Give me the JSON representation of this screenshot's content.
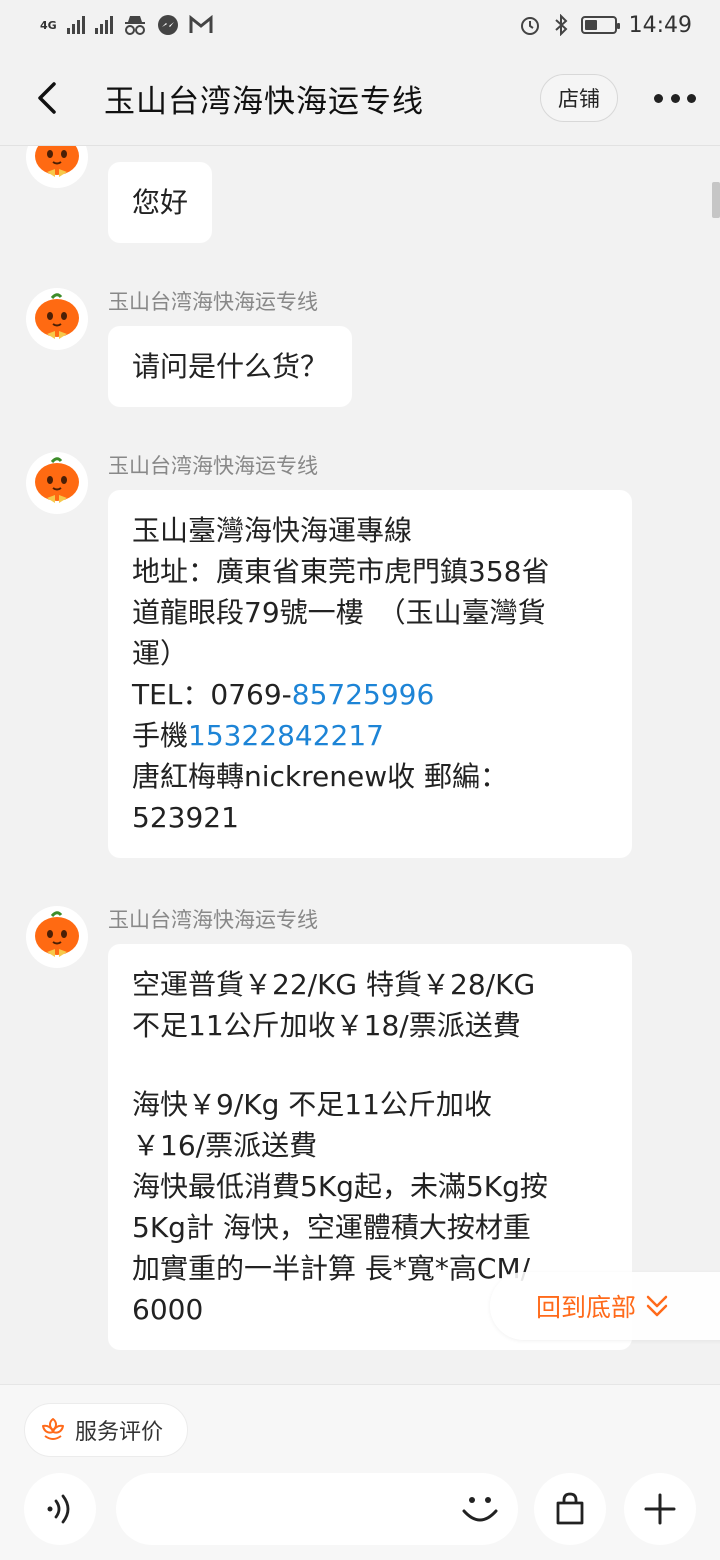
{
  "status_bar": {
    "network": "4G",
    "time": "14:49",
    "battery_level": 0.45,
    "icons": [
      "signal-4g-icon",
      "signal-icon",
      "incognito-icon",
      "messenger-icon",
      "gmail-icon",
      "alarm-icon",
      "bluetooth-icon",
      "battery-icon"
    ]
  },
  "header": {
    "title": "玉山台湾海快海运专线",
    "shop_label": "店铺",
    "icons": [
      "back-icon",
      "more-icon"
    ]
  },
  "messages": [
    {
      "lines": [
        "您好"
      ]
    },
    {
      "sender": "玉山台湾海快海运专线",
      "lines": [
        "请问是什么货？"
      ]
    },
    {
      "sender": "玉山台湾海快海运专线",
      "l1": "玉山臺灣海快海運專線",
      "l2": "地址：廣東省東莞市虎門鎮358省",
      "l3": "道龍眼段79號一樓　（玉山臺灣貨",
      "l4": "運）",
      "tel_prefix": "TEL：0769-",
      "tel_link": "85725996",
      "mobile_prefix": "手機",
      "mobile_link": "15322842217",
      "l7": "唐紅梅轉nickrenew收 郵編：",
      "l8": "523921"
    },
    {
      "sender": "玉山台湾海快海运专线",
      "lines": [
        "空運普貨￥22/KG 特貨￥28/KG",
        "不足11公斤加收￥18/票派送費",
        "",
        "海快￥9/Kg 不足11公斤加收",
        "￥16/票派送費",
        "海快最低消費5Kg起，未滿5Kg按",
        "5Kg計 海快，空運體積大按材重",
        "加實重的一半計算 長*寬*高CM/",
        "6000"
      ]
    }
  ],
  "back_to_bottom": {
    "label": "回到底部",
    "icon": "double-chevron-down-icon"
  },
  "bottom_bar": {
    "service_eval_label": "服务评价",
    "input_value": "",
    "icons": [
      "flower-icon",
      "voice-icon",
      "emoji-icon",
      "shopping-bag-icon",
      "plus-icon"
    ]
  },
  "colors": {
    "background": "#f2f2f2",
    "bubble": "#ffffff",
    "link": "#1d84d6",
    "accent": "#ff6a1a",
    "avatar": "#ff6a12"
  }
}
